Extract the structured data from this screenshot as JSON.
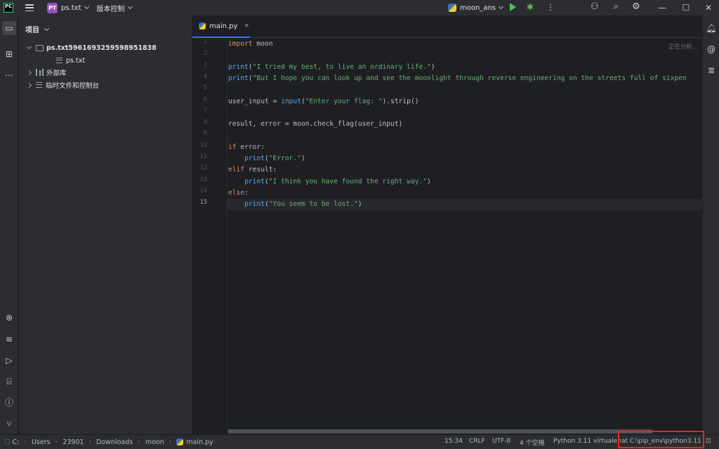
{
  "titlebar": {
    "logo": "PC",
    "project_badge": "PT",
    "project_name": "ps.txt",
    "vcs_label": "版本控制",
    "run_config": "moon_ans"
  },
  "project_panel": {
    "title": "项目",
    "tree": [
      {
        "label": "ps.txt5961693259598951838",
        "type": "folder",
        "expanded": true
      },
      {
        "label": "ps.txt",
        "type": "file"
      },
      {
        "label": "外部库",
        "type": "library",
        "expanded": false
      },
      {
        "label": "临时文件和控制台",
        "type": "scratches",
        "expanded": false
      }
    ]
  },
  "editor": {
    "tab": {
      "label": "main.py",
      "close": "×"
    },
    "analyzing": "正在分析...",
    "current_line": 15,
    "lines": [
      {
        "no": "1",
        "tokens": [
          {
            "t": "import",
            "c": "kw"
          },
          {
            "t": " moon",
            "c": "pnc"
          }
        ]
      },
      {
        "no": "2",
        "tokens": []
      },
      {
        "no": "3",
        "tokens": [
          {
            "t": "print",
            "c": "fn"
          },
          {
            "t": "(",
            "c": "pnc"
          },
          {
            "t": "\"I tried my best, to live an ordinary life.\"",
            "c": "str"
          },
          {
            "t": ")",
            "c": "pnc"
          }
        ]
      },
      {
        "no": "4",
        "tokens": [
          {
            "t": "print",
            "c": "fn"
          },
          {
            "t": "(",
            "c": "pnc"
          },
          {
            "t": "\"But I hope you can look up and see the moonlight through reverse engineering on the streets full of sixpen",
            "c": "str"
          }
        ]
      },
      {
        "no": "5",
        "tokens": []
      },
      {
        "no": "6",
        "tokens": [
          {
            "t": "user_input = ",
            "c": "pnc"
          },
          {
            "t": "input",
            "c": "fn"
          },
          {
            "t": "(",
            "c": "pnc"
          },
          {
            "t": "\"Enter your flag: \"",
            "c": "str"
          },
          {
            "t": ").strip()",
            "c": "pnc"
          }
        ]
      },
      {
        "no": "7",
        "tokens": []
      },
      {
        "no": "8",
        "tokens": [
          {
            "t": "result, error = moon.check_flag(user_input)",
            "c": "pnc"
          }
        ]
      },
      {
        "no": "9",
        "tokens": []
      },
      {
        "no": "10",
        "tokens": [
          {
            "t": "if",
            "c": "kw"
          },
          {
            "t": " error:",
            "c": "pnc"
          }
        ]
      },
      {
        "no": "11",
        "tokens": [
          {
            "t": "    ",
            "c": "pnc"
          },
          {
            "t": "print",
            "c": "fn"
          },
          {
            "t": "(",
            "c": "pnc"
          },
          {
            "t": "\"Error.\"",
            "c": "str"
          },
          {
            "t": ")",
            "c": "pnc"
          }
        ]
      },
      {
        "no": "12",
        "tokens": [
          {
            "t": "elif",
            "c": "kw"
          },
          {
            "t": " result:",
            "c": "pnc"
          }
        ]
      },
      {
        "no": "13",
        "tokens": [
          {
            "t": "    ",
            "c": "pnc"
          },
          {
            "t": "print",
            "c": "fn"
          },
          {
            "t": "(",
            "c": "pnc"
          },
          {
            "t": "\"I think you have found the right way.\"",
            "c": "str"
          },
          {
            "t": ")",
            "c": "pnc"
          }
        ]
      },
      {
        "no": "14",
        "tokens": [
          {
            "t": "else",
            "c": "kw"
          },
          {
            "t": ":",
            "c": "pnc"
          }
        ]
      },
      {
        "no": "15",
        "tokens": [
          {
            "t": "    ",
            "c": "pnc"
          },
          {
            "t": "print",
            "c": "fn"
          },
          {
            "t": "(",
            "c": "pnc"
          },
          {
            "t": "\"You seem to be lost.\"",
            "c": "str"
          },
          {
            "t": ")",
            "c": "pnc"
          }
        ]
      }
    ]
  },
  "statusbar": {
    "breadcrumbs": [
      "C:",
      "Users",
      "23901",
      "Downloads",
      "moon",
      "main.py"
    ],
    "position": "15:34",
    "line_sep": "CRLF",
    "encoding": "UTF-8",
    "indent": "4 个空格",
    "interpreter_prefix": "Python 3.11 virtualenv",
    "interpreter_path": "at C:\\pip_env\\python3.11"
  },
  "colors": {
    "accent": "#3574f0",
    "highlight_box": "#e8261f",
    "run_green": "#5fb865"
  }
}
